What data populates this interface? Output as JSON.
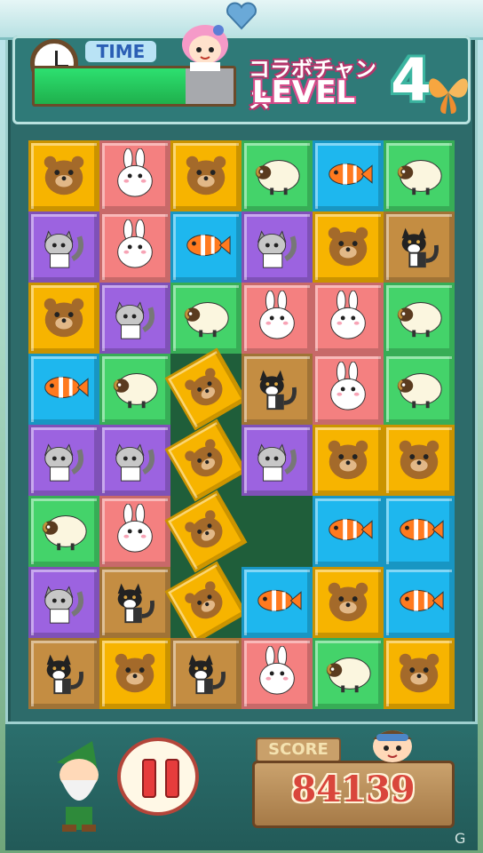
{
  "header": {
    "time_label": "TIME",
    "time_remaining": 0.76,
    "collab_text": "コラボチャンス",
    "level_text": "LEVEL",
    "level_number": "4"
  },
  "score": {
    "label": "SCORE",
    "value": "84139"
  },
  "colors": {
    "bear": "#f7b400",
    "rabbit": "#f48080",
    "sheep": "#44d36a",
    "fish": "#1eb7ee",
    "cat": "#9c63e0",
    "dog": "#c48d42"
  },
  "board": {
    "cols": 6,
    "rows": 8,
    "grid": [
      [
        "bear",
        "rabbit",
        "bear",
        "sheep",
        "fish",
        "sheep"
      ],
      [
        "cat",
        "rabbit",
        "fish",
        "cat",
        "bear",
        "dog"
      ],
      [
        "bear",
        "cat",
        "sheep",
        "rabbit",
        "rabbit",
        "sheep"
      ],
      [
        "fish",
        "sheep",
        "falling-bear",
        "dog",
        "rabbit",
        "sheep"
      ],
      [
        "cat",
        "cat",
        "falling-bear",
        "cat",
        "bear",
        "bear"
      ],
      [
        "sheep",
        "rabbit",
        "falling-bear",
        "empty",
        "fish",
        "fish"
      ],
      [
        "cat",
        "dog",
        "falling-bear",
        "fish",
        "bear",
        "fish"
      ],
      [
        "dog",
        "bear",
        "dog",
        "rabbit",
        "sheep",
        "bear"
      ]
    ]
  }
}
